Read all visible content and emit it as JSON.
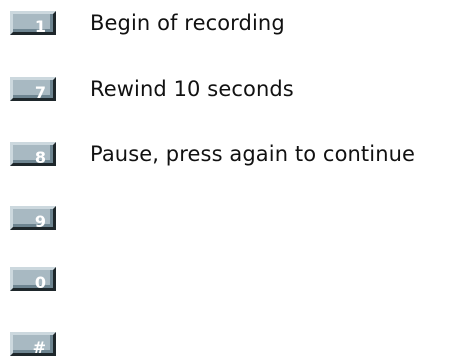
{
  "keys": [
    {
      "label": "1",
      "description": "Begin of recording"
    },
    {
      "label": "7",
      "description": "Rewind 10 seconds"
    },
    {
      "label": "8",
      "description": "Pause, press again to continue"
    },
    {
      "label": "9",
      "description": ""
    },
    {
      "label": "0",
      "description": ""
    },
    {
      "label": "#",
      "description": ""
    }
  ]
}
